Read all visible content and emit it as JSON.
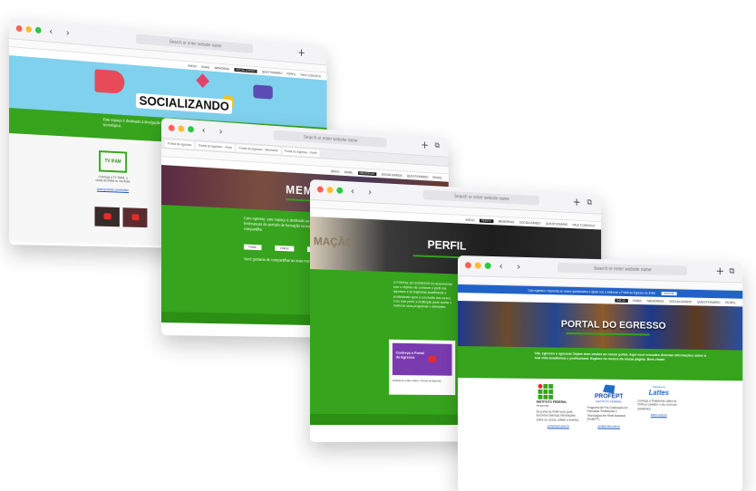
{
  "browser": {
    "search_placeholder": "Search or enter website name",
    "new_tab": "+",
    "tabs_icon": "⧉",
    "nav": "‹ ›"
  },
  "site_menu": {
    "items": [
      "INÍCIO",
      "EMAIL",
      "MEMÓRIAS",
      "SOCIALIZANDO",
      "QUESTIONÁRIO",
      "PERFIL",
      "FALE CONOSCO"
    ],
    "active_index": 3
  },
  "window1": {
    "banner_title": "SOCIALIZANDO",
    "intro": "Este espaço é destinado à divulgação de vídeos, notícias e informações sobre a educação profissional, científica e tecnológica.",
    "card_title": "TV IFAM",
    "card_text": "Conheça a TV IFAM, o canal do IFAM no YouTube",
    "card_link": "www.youtube.com/tvifam"
  },
  "window2": {
    "banner_title": "MEMÓRIAS",
    "intro": "Caro egresso, este espaço é destinado ao compartilhamento de suas memórias, fotos e lembranças do período de formação no instituto. Navegue pelo nosso acervo e compartilhe.",
    "buttons": [
      "Fotos",
      "Vídeos",
      "Relatos"
    ],
    "footer_text": "Você gostaria de compartilhar as suas memórias? Envie para o nosso e-mail.",
    "tabs": [
      "Portal do egresso",
      "Portal do egresso - Início",
      "Portal do Egresso - Memórias",
      "Portal do Egresso - Perfil",
      "Portal do Egresso"
    ]
  },
  "window3": {
    "banner_title": "PERFIL",
    "ghost_text": "MAÇÃO",
    "intro": "O PORTAL DO EGRESSO foi desenvolvido com o objetivo de conhecer o perfil dos egressos e as trajetórias acadêmicas e profissionais após a conclusão dos cursos. Com este perfil, a instituição pode avaliar e melhorar seus programas e atividades.",
    "video_title": "Conheça o Portal do Egresso",
    "video_caption": "Assista ao vídeo sobre o Portal do Egresso"
  },
  "window4": {
    "notice": "Caro egresso, responda ao nosso questionário e ajude-nos a melhorar o Portal do Egresso do IFAM.",
    "notice_button": "Acessar",
    "banner_title": "PORTAL DO EGRESSO",
    "intro": "Olá, egresso e egressa! Sejam bem-vindos ao nosso portal. Aqui você encontra diversas informações sobre a sua vida acadêmica e profissional. Explore os menus da nossa página. Bem-vindo!",
    "col1_logo": "INSTITUTO FEDERAL",
    "col1_logo_sub": "Amazonas",
    "col1_text": "No portal do IFAM você pode encontrar diversas informações sobre os cursos, editais e eventos.",
    "col1_link": "portal.ifam.edu.br",
    "col2_logo": "PROFEPT",
    "col2_logo_sub": "INSTITUTO FEDERAL",
    "col2_text": "Programa de Pós-Graduação em Educação Profissional e Tecnológica em Rede Nacional (ProfEPT).",
    "col2_link": "profept.ifes.edu.br",
    "col3_logo": "Lattes",
    "col3_logo_sub": "Plataforma",
    "col3_text": "Conheça a Plataforma Lattes do CNPq e cadastre o seu currículo acadêmico.",
    "col3_link": "lattes.cnpq.br"
  },
  "colors": {
    "green": "#36a41c",
    "dark_green": "#2b8f14",
    "banner_blue": "#7fd1ee",
    "notice_blue": "#2062c8"
  }
}
